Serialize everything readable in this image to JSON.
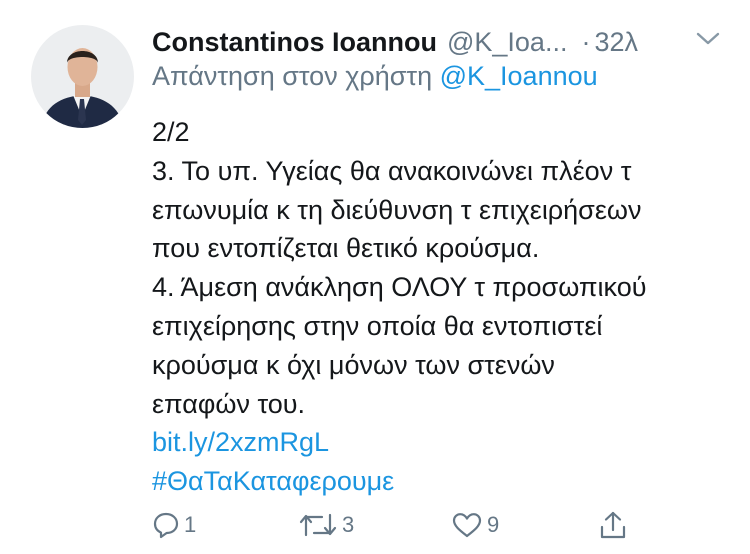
{
  "author": {
    "name": "Constantinos Ioannou",
    "handle": "@K_Ioa...",
    "separator": "·",
    "time": "32λ"
  },
  "reply": {
    "prefix": "Απάντηση στον χρήστη",
    "mention": "@K_Ioannou"
  },
  "body_lines": [
    "2/2",
    "3. Το υπ. Υγείας θα ανακοινώνει πλέον τ",
    "επωνυμία κ τη διεύθυνση τ επιχειρήσεων",
    "που εντοπίζεται θετικό κρούσμα.",
    "4. Άμεση ανάκληση ΟΛΟΥ τ προσωπικού",
    "επιχείρησης στην οποία θα εντοπιστεί",
    "κρούσμα κ όχι μόνων των στενών",
    "επαφών του."
  ],
  "link": "bit.ly/2xzmRgL",
  "hashtag": "#ΘαΤαΚαταφερουμε",
  "actions": {
    "reply_count": "1",
    "retweet_count": "3",
    "like_count": "9"
  },
  "colors": {
    "text": "#14171a",
    "secondary": "#657786",
    "link": "#1b95e0"
  },
  "icons": [
    "profile-avatar",
    "chevron-down-icon",
    "reply-icon",
    "retweet-icon",
    "like-icon",
    "share-icon"
  ]
}
